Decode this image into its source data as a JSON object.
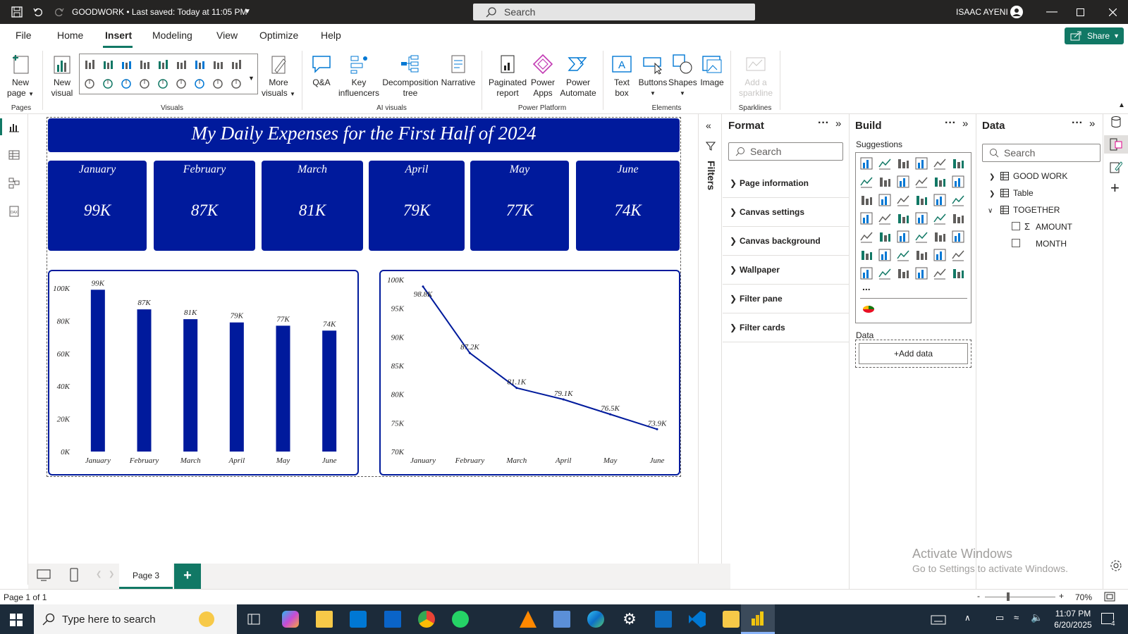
{
  "titlebar": {
    "file_title": "GOODWORK • Last saved: Today at 11:05 PM",
    "search_placeholder": "Search",
    "user_name": "ISAAC AYENI"
  },
  "menu": {
    "items": [
      "File",
      "Home",
      "Insert",
      "Modeling",
      "View",
      "Optimize",
      "Help"
    ],
    "active": "Insert",
    "share_label": "Share"
  },
  "ribbon": {
    "new_page": "New page",
    "new_visual": "New visual",
    "more_visuals": "More visuals",
    "qa": "Q&A",
    "key_influencers": "Key influencers",
    "decomposition_tree": "Decomposition tree",
    "narrative": "Narrative",
    "paginated_report": "Paginated report",
    "power_apps": "Power Apps",
    "power_automate": "Power Automate",
    "text_box": "Text box",
    "buttons": "Buttons",
    "shapes": "Shapes",
    "image": "Image",
    "add_sparkline": "Add a sparkline",
    "groups": {
      "pages": "Pages",
      "visuals": "Visuals",
      "ai_visuals": "AI visuals",
      "power_platform": "Power Platform",
      "elements": "Elements",
      "sparklines": "Sparklines"
    }
  },
  "report": {
    "title": "My Daily Expenses for the First Half of 2024",
    "cards": [
      {
        "month": "January",
        "value": "99K"
      },
      {
        "month": "February",
        "value": "87K"
      },
      {
        "month": "March",
        "value": "81K"
      },
      {
        "month": "April",
        "value": "79K"
      },
      {
        "month": "May",
        "value": "77K"
      },
      {
        "month": "June",
        "value": "74K"
      }
    ]
  },
  "chart_data": [
    {
      "type": "bar",
      "categories": [
        "January",
        "February",
        "March",
        "April",
        "May",
        "June"
      ],
      "values": [
        99,
        87,
        81,
        79,
        77,
        74
      ],
      "data_labels": [
        "99K",
        "87K",
        "81K",
        "79K",
        "77K",
        "74K"
      ],
      "ylim": [
        0,
        100
      ],
      "yticks": [
        "0K",
        "20K",
        "40K",
        "60K",
        "80K",
        "100K"
      ],
      "grid": false,
      "bar_color": "#001a9c"
    },
    {
      "type": "line",
      "categories": [
        "January",
        "February",
        "March",
        "April",
        "May",
        "June"
      ],
      "values": [
        98.8,
        87.2,
        81.1,
        79.1,
        76.5,
        73.9
      ],
      "data_labels": [
        "98.8K",
        "87.2K",
        "81.1K",
        "79.1K",
        "76.5K",
        "73.9K"
      ],
      "ylim": [
        70,
        100
      ],
      "yticks": [
        "70K",
        "75K",
        "80K",
        "85K",
        "90K",
        "95K",
        "100K"
      ],
      "grid": false,
      "line_color": "#001a9c"
    }
  ],
  "filters_label": "Filters",
  "format_pane": {
    "title": "Format",
    "search_placeholder": "Search",
    "sections": [
      "Page information",
      "Canvas settings",
      "Canvas background",
      "Wallpaper",
      "Filter pane",
      "Filter cards"
    ]
  },
  "build_pane": {
    "title": "Build",
    "suggestions_label": "Suggestions",
    "data_label": "Data",
    "add_data": "+Add data",
    "more": "..."
  },
  "data_pane": {
    "title": "Data",
    "search_placeholder": "Search",
    "tables": [
      "GOOD WORK",
      "Table",
      "TOGETHER"
    ],
    "fields": [
      "AMOUNT",
      "MONTH"
    ]
  },
  "pages": {
    "tab": "Page 3",
    "add": "+"
  },
  "status": {
    "page_info": "Page 1 of 1",
    "zoom": "70%"
  },
  "watermark": {
    "line1": "Activate Windows",
    "line2": "Go to Settings to activate Windows."
  },
  "taskbar": {
    "search_placeholder": "Type here to search",
    "time": "11:07 PM",
    "date": "6/20/2025",
    "notification_count": "4"
  }
}
